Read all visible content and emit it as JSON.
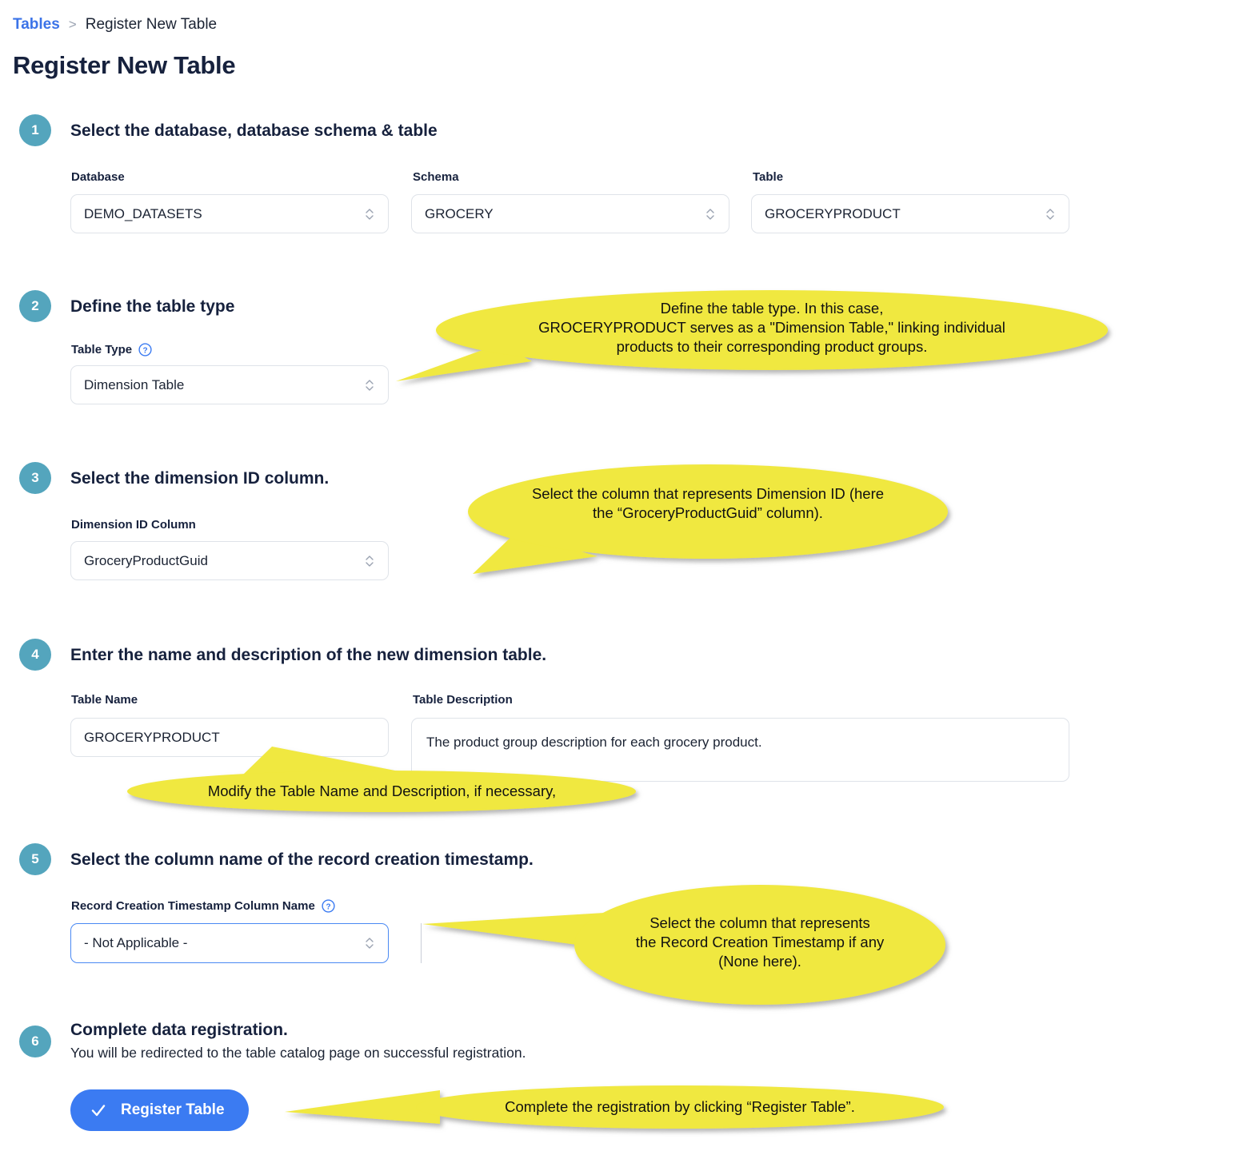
{
  "breadcrumb": {
    "parent": "Tables",
    "separator": ">",
    "current": "Register New Table"
  },
  "page_title": "Register New Table",
  "steps": [
    {
      "number": "1",
      "title": "Select the database, database schema & table",
      "subtitle": ""
    },
    {
      "number": "2",
      "title": "Define the table type",
      "subtitle": ""
    },
    {
      "number": "3",
      "title": "Select the dimension ID column.",
      "subtitle": ""
    },
    {
      "number": "4",
      "title": "Enter the name and description of the new dimension table.",
      "subtitle": ""
    },
    {
      "number": "5",
      "title": "Select the column name of the record creation timestamp.",
      "subtitle": ""
    },
    {
      "number": "6",
      "title": "Complete data registration.",
      "subtitle": "You will be redirected to the table catalog page on successful registration."
    }
  ],
  "fields": {
    "database": {
      "label": "Database",
      "value": "DEMO_DATASETS"
    },
    "schema": {
      "label": "Schema",
      "value": "GROCERY"
    },
    "table": {
      "label": "Table",
      "value": "GROCERYPRODUCT"
    },
    "table_type": {
      "label": "Table Type",
      "value": "Dimension Table",
      "help": "help-icon"
    },
    "dimension_id_column": {
      "label": "Dimension ID Column",
      "value": "GroceryProductGuid"
    },
    "table_name": {
      "label": "Table Name",
      "value": "GROCERYPRODUCT"
    },
    "table_description": {
      "label": "Table Description",
      "value": "The product group description for each grocery product."
    },
    "record_creation_timestamp": {
      "label": "Record Creation Timestamp Column Name",
      "value": "- Not Applicable -",
      "help": "help-icon"
    }
  },
  "register_button": {
    "label": "Register Table",
    "icon": "check-icon"
  },
  "callouts": [
    {
      "id": "callout-table-type",
      "text": "Define the table type. In this case,\nGROCERYPRODUCT serves as a \"Dimension Table,\" linking individual\nproducts to their corresponding product groups."
    },
    {
      "id": "callout-dimension-id",
      "text": "Select the column that represents Dimension ID (here\nthe “GroceryProductGuid” column)."
    },
    {
      "id": "callout-table-name",
      "text": "Modify the Table Name and Description, if necessary,"
    },
    {
      "id": "callout-timestamp",
      "text": "Select the column that represents\nthe Record Creation Timestamp if any\n(None here)."
    },
    {
      "id": "callout-register",
      "text": "Complete the registration by clicking “Register Table”."
    }
  ],
  "colors": {
    "step_badge": "#54a5bd",
    "primary_button": "#3b7bf2",
    "link": "#3b73e8",
    "callout_fill": "#f0e83f",
    "text": "#16213d",
    "border": "#dfe3e9",
    "focus_border": "#4a89f3"
  }
}
